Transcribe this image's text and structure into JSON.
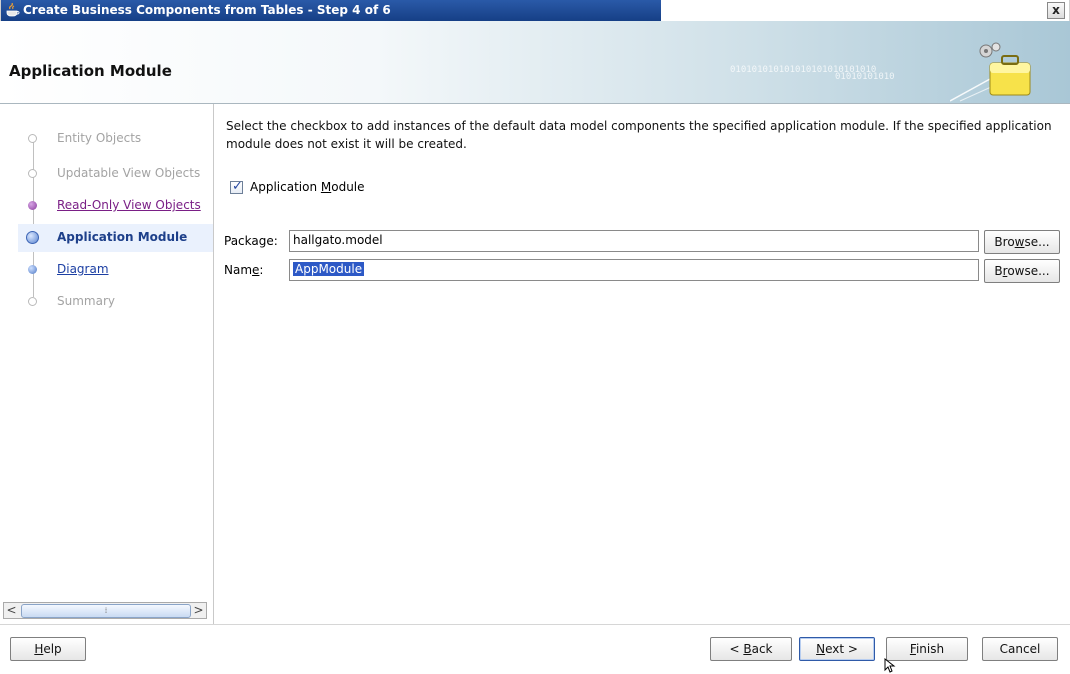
{
  "window": {
    "title": "Create Business Components from Tables - Step 4 of 6",
    "close_label": "x"
  },
  "header": {
    "title": "Application Module",
    "binary_line1": "010101010101010101010101010",
    "binary_line2": "01010101010"
  },
  "nav": {
    "items": [
      {
        "label": "Entity Objects",
        "state": "disabled"
      },
      {
        "label": "Updatable View Objects",
        "state": "disabled"
      },
      {
        "label": "Read-Only View Objects",
        "state": "visited"
      },
      {
        "label": "Application Module",
        "state": "current"
      },
      {
        "label": "Diagram",
        "state": "link"
      },
      {
        "label": "Summary",
        "state": "disabled"
      }
    ],
    "scroll_left": "<",
    "scroll_right": ">",
    "scroll_grip": "⁞"
  },
  "content": {
    "description": "Select the checkbox to add instances of the default data model components the specified application module.  If the specified application module does not exist it will be created.",
    "checkbox": {
      "checked": true,
      "label_pre": "Application ",
      "label_mnemonic": "M",
      "label_post": "odule"
    },
    "package": {
      "label": "Package:",
      "value": "hallgato.model",
      "browse_pre": "Bro",
      "browse_mnemonic": "w",
      "browse_post": "se..."
    },
    "name": {
      "label_pre": "Nam",
      "label_mnemonic": "e",
      "label_post": ":",
      "value": "AppModule",
      "browse_pre": "B",
      "browse_mnemonic": "r",
      "browse_post": "owse..."
    }
  },
  "footer": {
    "help": {
      "mnemonic": "H",
      "rest": "elp"
    },
    "back": {
      "pre": "< ",
      "mnemonic": "B",
      "rest": "ack"
    },
    "next": {
      "pre": "",
      "mnemonic": "N",
      "rest": "ext >"
    },
    "finish": {
      "mnemonic": "F",
      "rest": "inish"
    },
    "cancel": "Cancel"
  },
  "colors": {
    "title_bar": "#1e4b96",
    "selection": "#2d59c6",
    "current_step": "#1d3f8a",
    "visited_step": "#7a1f86"
  }
}
